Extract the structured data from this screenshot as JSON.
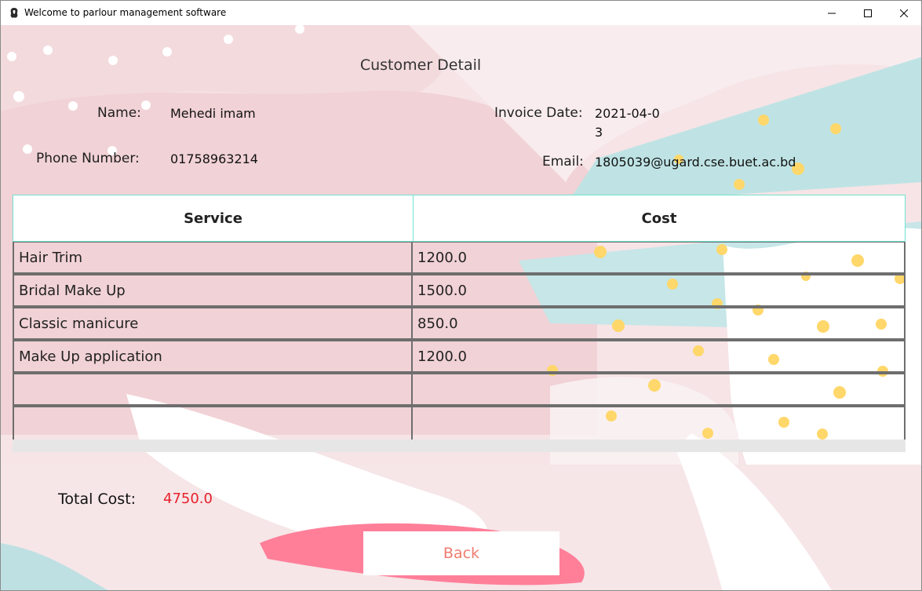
{
  "window": {
    "title": "Welcome to parlour management software"
  },
  "page": {
    "heading": "Customer Detail"
  },
  "customer": {
    "name_label": "Name:",
    "name_value": "Mehedi imam",
    "phone_label": "Phone Number:",
    "phone_value": "01758963214",
    "invoice_date_label": "Invoice Date:",
    "invoice_date_value_line1": "2021-04-0",
    "invoice_date_value_line2": "3",
    "email_label": "Email:",
    "email_value": "1805039@ugard.cse.buet.ac.bd"
  },
  "table": {
    "columns": [
      "Service",
      "Cost"
    ],
    "rows": [
      [
        "Hair Trim",
        "1200.0"
      ],
      [
        "Bridal Make Up",
        "1500.0"
      ],
      [
        "Classic manicure",
        "850.0"
      ],
      [
        "Make Up application",
        "1200.0"
      ],
      [
        "",
        ""
      ],
      [
        "",
        ""
      ]
    ]
  },
  "total": {
    "label": "Total Cost:",
    "value": "4750.0"
  },
  "actions": {
    "back_label": "Back"
  },
  "colors": {
    "accent_teal": "#6fe3cf",
    "total_value": "#e8202a",
    "back_text": "#ef7b6e",
    "pink_stroke": "#ff7f99"
  }
}
